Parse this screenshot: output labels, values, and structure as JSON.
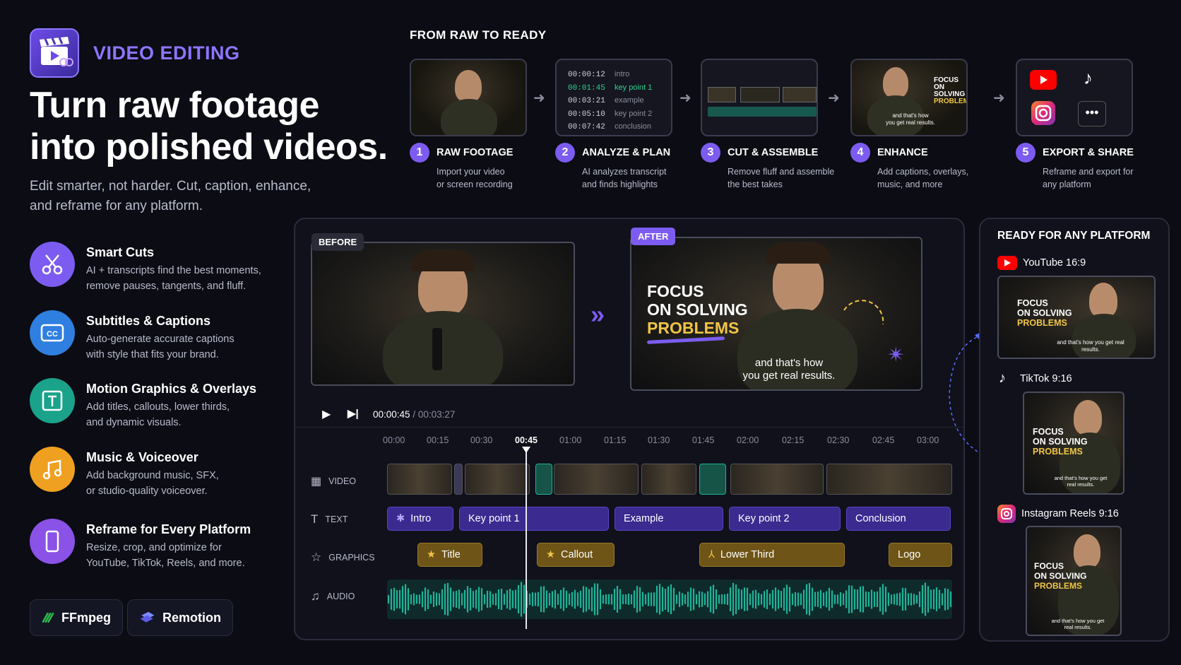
{
  "header": {
    "brand": "VIDEO EDITING",
    "headline_line1": "Turn raw footage",
    "headline_line2": "into polished videos.",
    "subtitle_line1": "Edit smarter, not harder. Cut, caption, enhance,",
    "subtitle_line2": "and reframe for any platform."
  },
  "features": [
    {
      "title": "Smart Cuts",
      "desc1": "AI + transcripts find the best moments,",
      "desc2": "remove pauses, tangents, and fluff.",
      "icon": "scissors-icon",
      "color": "#7c5cf0"
    },
    {
      "title": "Subtitles & Captions",
      "desc1": "Auto-generate accurate captions",
      "desc2": "with style that fits your brand.",
      "icon": "cc-icon",
      "color": "#2f7fe0"
    },
    {
      "title": "Motion Graphics & Overlays",
      "desc1": "Add titles, callouts, lower thirds,",
      "desc2": "and dynamic visuals.",
      "icon": "text-frame-icon",
      "color": "#1aa38a"
    },
    {
      "title": "Music & Voiceover",
      "desc1": "Add background music, SFX,",
      "desc2": "or studio-quality voiceover.",
      "icon": "music-note-icon",
      "color": "#f0a020"
    },
    {
      "title": "Reframe for Every Platform",
      "desc1": "Resize, crop, and optimize for",
      "desc2": "YouTube, TikTok, Reels, and more.",
      "icon": "phone-icon",
      "color": "#8a52e6"
    }
  ],
  "tools": [
    "FFmpeg",
    "Remotion"
  ],
  "steps_title": "FROM RAW TO READY",
  "steps": [
    {
      "num": "1",
      "title": "RAW FOOTAGE",
      "desc1": "Import your video",
      "desc2": "or screen recording"
    },
    {
      "num": "2",
      "title": "ANALYZE & PLAN",
      "desc1": "AI analyzes transcript",
      "desc2": "and finds highlights"
    },
    {
      "num": "3",
      "title": "CUT & ASSEMBLE",
      "desc1": "Remove fluff and assemble",
      "desc2": "the best takes"
    },
    {
      "num": "4",
      "title": "ENHANCE",
      "desc1": "Add captions, overlays,",
      "desc2": "music, and more"
    },
    {
      "num": "5",
      "title": "EXPORT & SHARE",
      "desc1": "Reframe and export for",
      "desc2": "any platform"
    }
  ],
  "transcript": [
    {
      "time": "00:00:12",
      "label": "intro"
    },
    {
      "time": "00:01:45",
      "label": "key point 1"
    },
    {
      "time": "00:03:21",
      "label": "example"
    },
    {
      "time": "00:05:10",
      "label": "key point 2"
    },
    {
      "time": "00:07:42",
      "label": "conclusion"
    }
  ],
  "overlay": {
    "line1": "FOCUS",
    "line2": "ON SOLVING",
    "line3": "PROBLEMS",
    "caption1": "and that's how",
    "caption2": "you get real results.",
    "caption_small": "and that's how you get real results."
  },
  "editor": {
    "before_tag": "BEFORE",
    "after_tag": "AFTER",
    "current_time": "00:00:45",
    "total_time": "/ 00:03:27",
    "ticks": [
      "00:00",
      "00:15",
      "00:30",
      "00:45",
      "01:00",
      "01:15",
      "01:30",
      "01:45",
      "02:00",
      "02:15",
      "02:30",
      "02:45",
      "03:00"
    ],
    "tracks": {
      "video": "VIDEO",
      "text": "TEXT",
      "graphics": "GRAPHICS",
      "audio": "AUDIO"
    },
    "text_clips": [
      "Intro",
      "Key point 1",
      "Example",
      "Key point 2",
      "Conclusion"
    ],
    "graphic_clips": [
      "Title",
      "Callout",
      "Lower Third",
      "Logo"
    ]
  },
  "platforms": {
    "title": "READY FOR ANY PLATFORM",
    "youtube": "YouTube 16:9",
    "tiktok": "TikTok 9:16",
    "instagram": "Instagram Reels 9:16"
  },
  "colors": {
    "accent": "#7c5cf0",
    "brand": "#8e75ff",
    "highlight": "#f0c545",
    "wave": "#1fb39a"
  }
}
